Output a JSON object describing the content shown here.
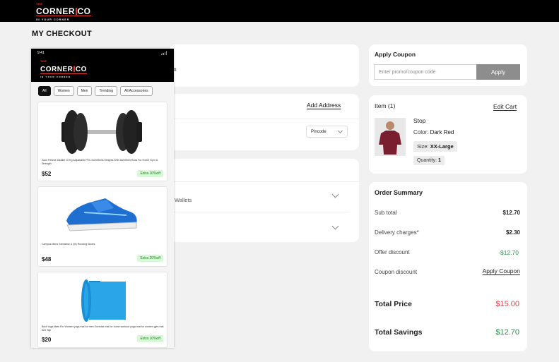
{
  "app": {
    "logo_small": "THE",
    "logo_main_left": "CORNER",
    "logo_main_right": "CO",
    "logo_tagline": "IN YOUR CORNER",
    "page_title": "MY CHECKOUT"
  },
  "phone": {
    "time": "9:41",
    "filters": [
      "All",
      "Women",
      "Men",
      "Trending",
      "All Accessories"
    ],
    "products": [
      {
        "name": "Zuko Fitness Ideallet 10 Kg Adjustable PVC Dumbbells Weights With Dumbbell Rods For Home Gym & Strength",
        "price": "$52",
        "offer": "Extra 10%off",
        "icon": "dumbbell-icon"
      },
      {
        "name": "Campus Mens Sematech 1 (M) Running Shoes",
        "price": "$48",
        "offer": "Extra 20%off",
        "icon": "running-shoe-icon"
      },
      {
        "name": "Bold Yoga Mats For Women yoga mat for men Exercise mat for home workout yoga mat for women gym mat Anti Slip",
        "price": "$20",
        "offer": "Extra 10%off",
        "icon": "yoga-mat-icon"
      }
    ]
  },
  "hidden_partial": {
    "text_fragment": "m",
    "add_address": "Add Address",
    "pincode_label": "Pincode",
    "payment_option": "Wallets"
  },
  "coupon": {
    "title": "Apply Coupon",
    "placeholder": "Enter promo/coupon code",
    "apply_label": "Apply"
  },
  "item": {
    "header": "Item (1)",
    "edit_cart": "Edit Cart",
    "name": "Stop",
    "color_label": "Color:",
    "color_value": "Dark Red",
    "size_label": "Size:",
    "size_value": "XX-Large",
    "qty_label": "Quantity:",
    "qty_value": "1",
    "swatch": "#7a1f2f"
  },
  "summary": {
    "title": "Order Summary",
    "rows": [
      {
        "label": "Sub total",
        "value": "$12.70"
      },
      {
        "label": "Delivery charges*",
        "value": "$2.30"
      },
      {
        "label": "Offer discount",
        "value": "-$12.70"
      },
      {
        "label": "Coupon discount",
        "value": "Apply Coupon"
      }
    ],
    "total_price_label": "Total Price",
    "total_price_value": "$15.00",
    "total_savings_label": "Total Savings",
    "total_savings_value": "$12.70",
    "colors": {
      "total_price": "#e0474c",
      "savings": "#2f8f4e",
      "offer": "#2f8f4e"
    }
  }
}
